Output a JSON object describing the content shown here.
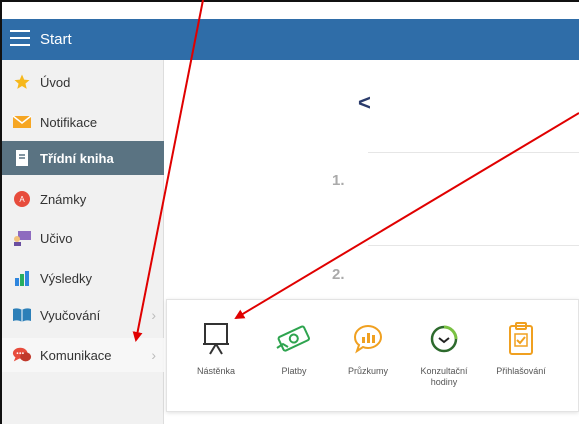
{
  "header": {
    "title": "Start",
    "menu_icon": "hamburger-icon",
    "color": "#2f6da8"
  },
  "sidebar": {
    "items": [
      {
        "label": "Úvod",
        "icon": "star-icon"
      },
      {
        "label": "Notifikace",
        "icon": "envelope-icon"
      },
      {
        "label": "Třídní kniha",
        "icon": "notebook-icon"
      },
      {
        "label": "Známky",
        "icon": "grade-badge-icon"
      },
      {
        "label": "Učivo",
        "icon": "teacher-board-icon"
      },
      {
        "label": "Výsledky",
        "icon": "bar-chart-icon"
      },
      {
        "label": "Vyučování",
        "icon": "book-icon"
      },
      {
        "label": "Komunikace",
        "icon": "chat-bubbles-icon"
      }
    ],
    "active_index": 2,
    "active_color": "#5a7382"
  },
  "main": {
    "back_symbol": "<",
    "sections": [
      {
        "number": "1."
      },
      {
        "number": "2."
      }
    ]
  },
  "communication_menu": {
    "tiles": [
      {
        "label": "Nástěnka",
        "icon": "bulletin-board-icon"
      },
      {
        "label": "Platby",
        "icon": "money-icon"
      },
      {
        "label": "Průzkumy",
        "icon": "survey-icon"
      },
      {
        "label": "Konzultační hodiny",
        "icon": "clock-icon"
      },
      {
        "label": "Přihlašování",
        "icon": "clipboard-check-icon"
      }
    ]
  },
  "annotations": {
    "arrow_color": "#e00000"
  }
}
